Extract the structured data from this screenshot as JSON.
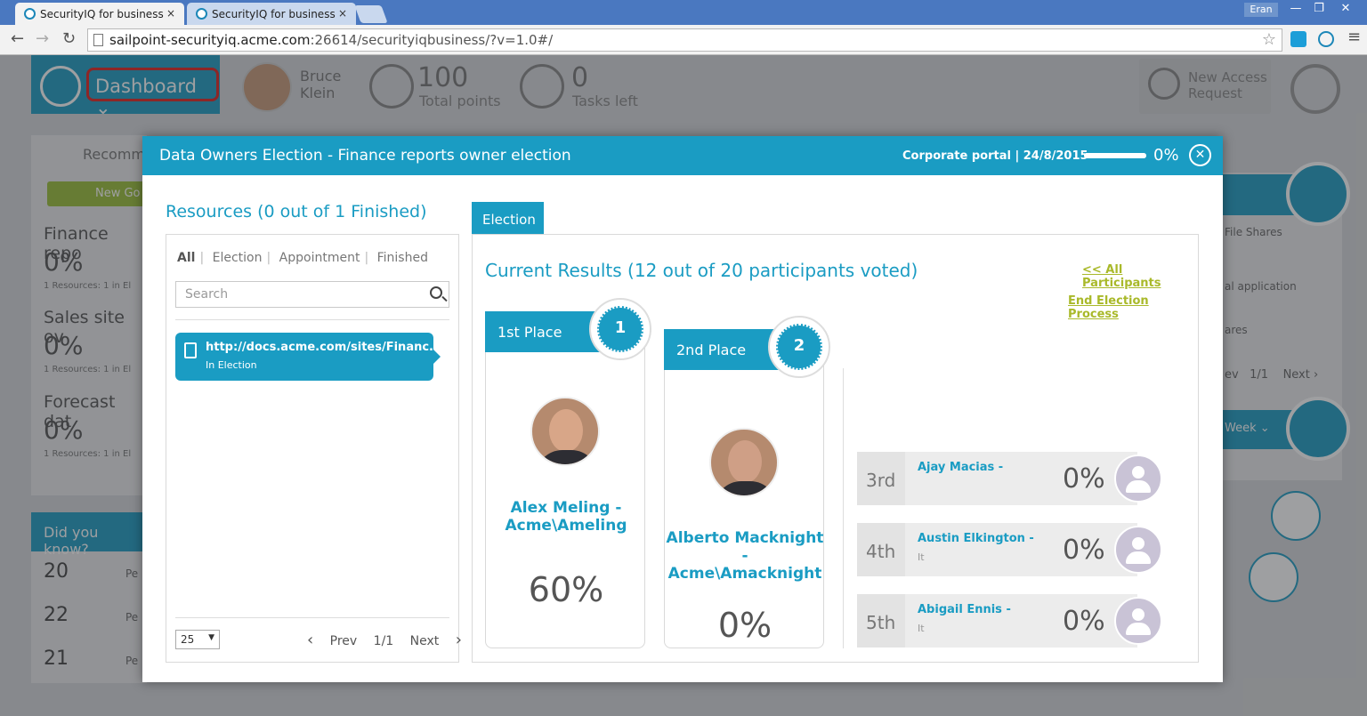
{
  "browser": {
    "tabs": [
      {
        "title": "SecurityIQ for business",
        "close": "×"
      },
      {
        "title": "SecurityIQ for business",
        "close": "×"
      }
    ],
    "user": "Eran",
    "url_host": "sailpoint-securityiq.acme.com",
    "url_rest": ":26614/securityiqbusiness/?v=1.0#/",
    "window_controls": [
      "—",
      "❐",
      "✕"
    ]
  },
  "header": {
    "dashboard_label": "Dashboard",
    "user_first": "Bruce",
    "user_last": "Klein",
    "points_value": "100",
    "points_label": "Total points",
    "tasks_value": "0",
    "tasks_label": "Tasks left",
    "new_access_line1": "New Access",
    "new_access_line2": "Request"
  },
  "background": {
    "recommend_label": "Recomm",
    "new_go_label": "New Go",
    "items": [
      {
        "title": "Finance repo",
        "pct": "0%",
        "sub": "1 Resources: 1 in El"
      },
      {
        "title": "Sales site ov",
        "pct": "0%",
        "sub": "1 Resources: 1 in El"
      },
      {
        "title": "Forecast dat",
        "pct": "0%",
        "sub": "1 Resources: 1 in El"
      }
    ],
    "did_you_know": "Did you know?",
    "dk_rows": [
      {
        "num": "20",
        "txt": "Pe"
      },
      {
        "num": "22",
        "txt": "Pe"
      },
      {
        "num": "21",
        "txt": "Pe"
      }
    ],
    "right_texts": [
      "File Shares",
      "al application",
      "ares"
    ],
    "right_pager": {
      "prev": "ev",
      "page": "1/1",
      "next": "Next"
    },
    "week_label": "Week"
  },
  "modal": {
    "title": "Data Owners Election - Finance reports owner election",
    "meta": "Corporate portal | 24/8/2015",
    "progress_pct": "0%",
    "progress_fraction": 1.0,
    "close": "✕"
  },
  "resources": {
    "title": "Resources (0 out of 1 Finished)",
    "filters": [
      "All",
      "Election",
      "Appointment",
      "Finished"
    ],
    "search_placeholder": "Search",
    "items": [
      {
        "url": "http://docs.acme.com/sites/Financ...",
        "state": "In Election"
      }
    ],
    "page_size": "25",
    "pager": {
      "prev": "Prev",
      "page": "1/1",
      "next": "Next"
    }
  },
  "election": {
    "tab_label": "Election",
    "results_title": "Current Results (12 out of 20 participants voted)",
    "link_all": "<< All Participants",
    "link_end": "End Election Process",
    "places": [
      {
        "place": "1st Place",
        "badge": "1",
        "name_line1": "Alex Meling -",
        "name_line2": "Acme\\Ameling",
        "name_line3": "",
        "pct": "60%"
      },
      {
        "place": "2nd Place",
        "badge": "2",
        "name_line1": "Alberto Macknight",
        "name_line2": "-",
        "name_line3": "Acme\\Amacknight",
        "pct": "0%"
      }
    ],
    "ranks": [
      {
        "rank": "3rd",
        "name": "Ajay Macias -",
        "dept": "",
        "pct": "0%"
      },
      {
        "rank": "4th",
        "name": "Austin Elkington -",
        "dept": "It",
        "pct": "0%"
      },
      {
        "rank": "5th",
        "name": "Abigail Ennis -",
        "dept": "It",
        "pct": "0%"
      }
    ]
  },
  "colors": {
    "accent": "#1a9cc3",
    "link_green": "#a9b92a",
    "highlight_red": "#e0231f"
  }
}
